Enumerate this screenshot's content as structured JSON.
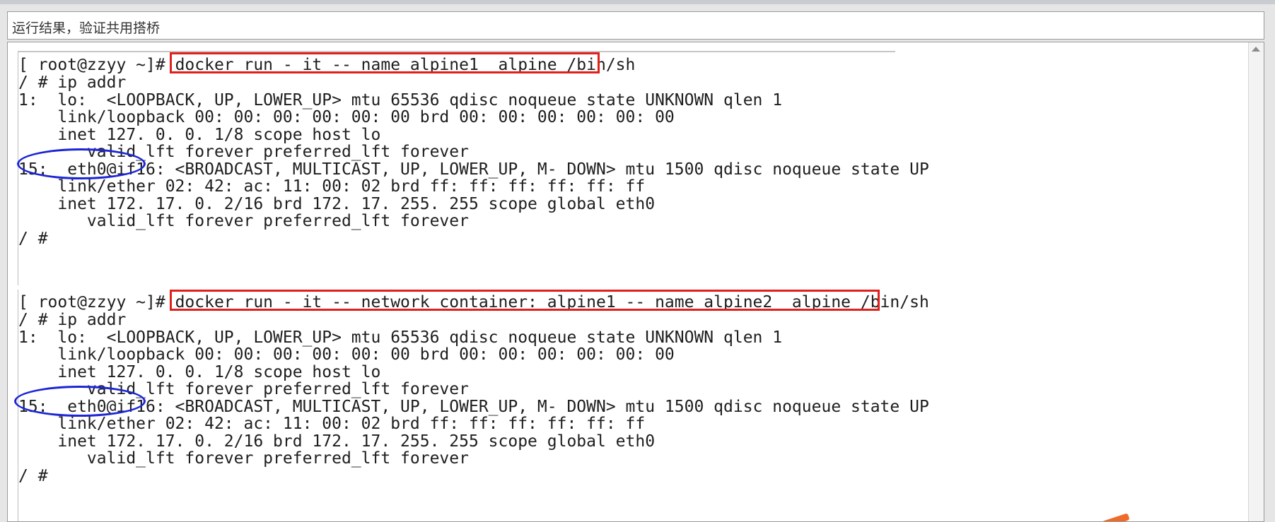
{
  "title": "运行结果，验证共用搭桥",
  "terminal_1": {
    "prompt": "[ root@zzyy ~]# ",
    "command": "docker run - it -- name alpine1  alpine /bin/sh",
    "lines": [
      "/ # ip addr",
      "1:  lo:  <LOOPBACK, UP, LOWER_UP> mtu 65536 qdisc noqueue state UNKNOWN qlen 1",
      "    link/loopback 00: 00: 00: 00: 00: 00 brd 00: 00: 00: 00: 00: 00",
      "    inet 127. 0. 0. 1/8 scope host lo",
      "       valid_lft forever preferred_lft forever",
      "15:  eth0@if16: <BROADCAST, MULTICAST, UP, LOWER_UP, M- DOWN> mtu 1500 qdisc noqueue state UP",
      "    link/ether 02: 42: ac: 11: 00: 02 brd ff: ff: ff: ff: ff: ff",
      "    inet 172. 17. 0. 2/16 brd 172. 17. 255. 255 scope global eth0",
      "       valid_lft forever preferred_lft forever",
      "/ #"
    ]
  },
  "terminal_2": {
    "prompt": "[ root@zzyy ~]# ",
    "command": "docker run - it -- network container: alpine1 -- name alpine2  alpine /bin/sh",
    "lines": [
      "/ # ip addr",
      "1:  lo:  <LOOPBACK, UP, LOWER_UP> mtu 65536 qdisc noqueue state UNKNOWN qlen 1",
      "    link/loopback 00: 00: 00: 00: 00: 00 brd 00: 00: 00: 00: 00: 00",
      "    inet 127. 0. 0. 1/8 scope host lo",
      "       valid_lft forever preferred_lft forever",
      "15:  eth0@if16: <BROADCAST, MULTICAST, UP, LOWER_UP, M- DOWN> mtu 1500 qdisc noqueue state UP",
      "    link/ether 02: 42: ac: 11: 00: 02 brd ff: ff: ff: ff: ff: ff",
      "    inet 172. 17. 0. 2/16 brd 172. 17. 255. 255 scope global eth0",
      "       valid_lft forever preferred_lft forever",
      "/ #"
    ]
  },
  "colors": {
    "command_highlight": "#e0201b",
    "interface_highlight": "#1b25d6"
  },
  "icons": {
    "scroll_up": "scroll-up-arrow-icon"
  }
}
